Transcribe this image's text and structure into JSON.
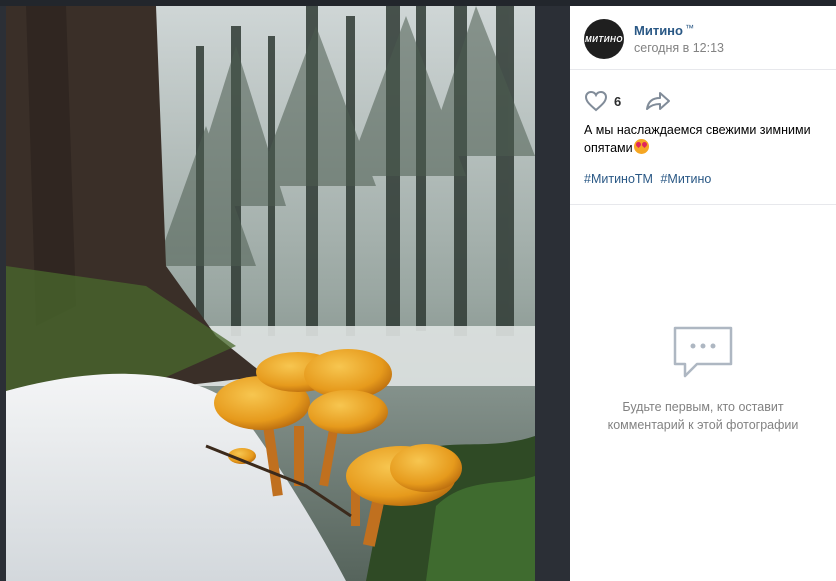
{
  "post": {
    "author_name": "Митино",
    "author_mark": "™",
    "avatar_label": "МИТИНО",
    "time": "сегодня в 12:13",
    "like_count": "6",
    "caption": "А мы наслаждаемся свежими зимними опятами",
    "hashtags": [
      "#МитиноТМ",
      "#Митино"
    ]
  },
  "comments": {
    "empty_text": "Будьте первым, кто оставит комментарий к этой фотографии"
  },
  "icons": {
    "like": "heart-icon",
    "share": "share-arrow-icon",
    "comments_empty": "comment-bubble-icon",
    "emoji": "heart-eyes-emoji"
  },
  "colors": {
    "link": "#2a5885",
    "muted": "#828282",
    "mushroom": "#e9a21f"
  }
}
